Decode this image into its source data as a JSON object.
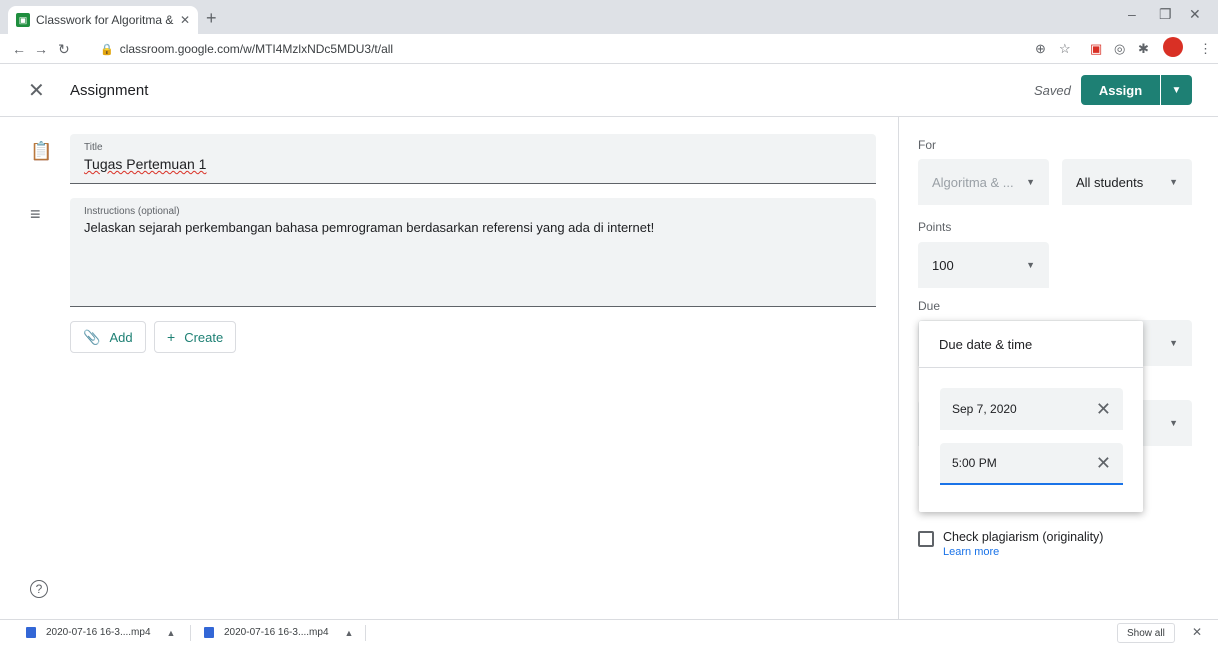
{
  "browser": {
    "tab_title": "Classwork for Algoritma & Pemrog",
    "url": "classroom.google.com/w/MTI4MzlxNDc5MDU3/t/all"
  },
  "header": {
    "title": "Assignment",
    "saved": "Saved",
    "assign_label": "Assign"
  },
  "form": {
    "title_label": "Title",
    "title_value": "Tugas Pertemuan 1",
    "instructions_label": "Instructions (optional)",
    "instructions_value": "Jelaskan sejarah perkembangan bahasa pemrograman berdasarkan referensi yang ada di internet!",
    "add_label": "Add",
    "create_label": "Create"
  },
  "panel": {
    "for_label": "For",
    "class_value": "Algoritma & ...",
    "students_value": "All students",
    "points_label": "Points",
    "points_value": "100",
    "due_label": "Due",
    "plagiarism_label": "Check plagiarism (originality)",
    "learn_more": "Learn more"
  },
  "due_popup": {
    "title": "Due date & time",
    "date": "Sep 7, 2020",
    "time": "5:00 PM"
  },
  "downloads": {
    "items": [
      "2020-07-16 16-3....mp4",
      "2020-07-16 16-3....mp4"
    ],
    "show_all": "Show all"
  }
}
